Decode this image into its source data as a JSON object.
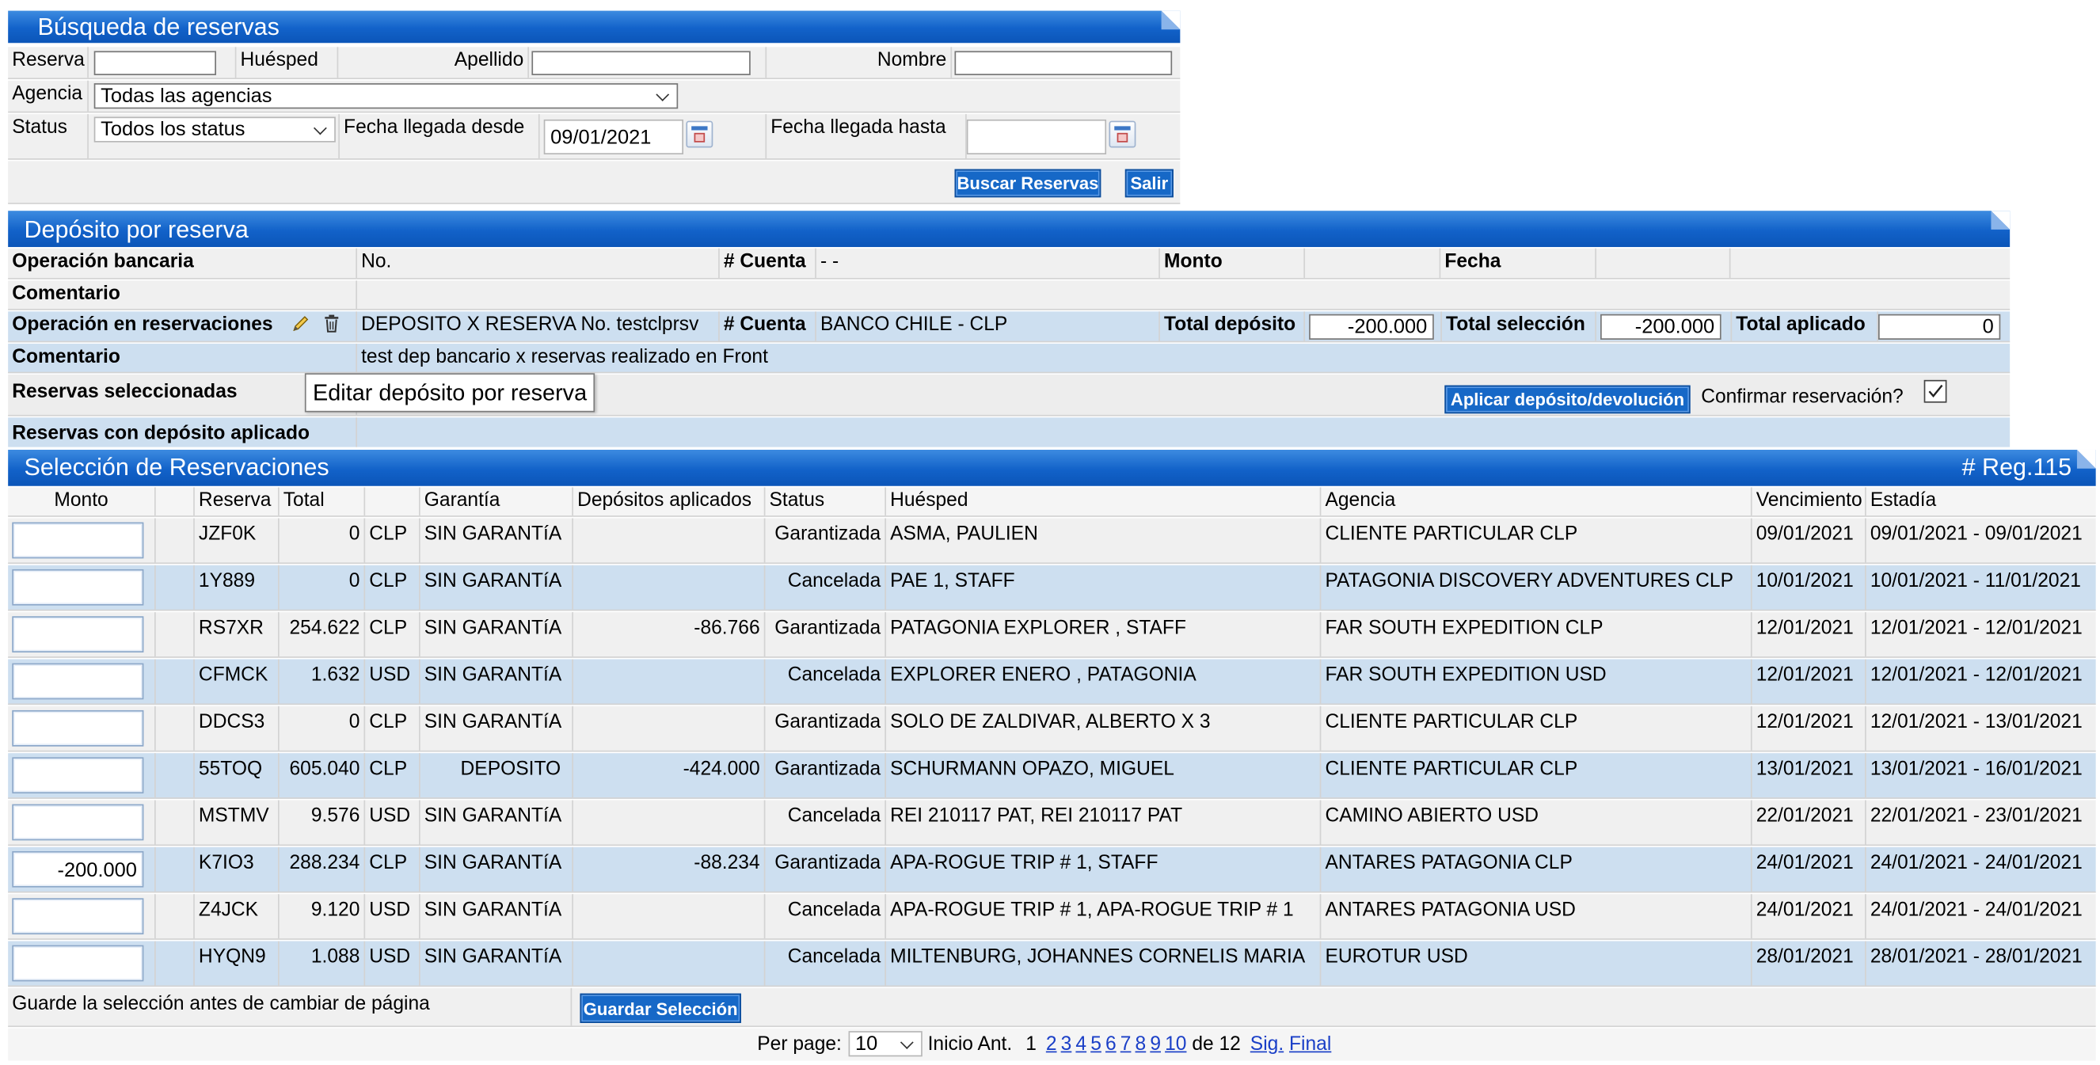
{
  "search": {
    "title": "Búsqueda de reservas",
    "reserva_label": "Reserva",
    "huesped_label": "Huésped",
    "apellido_label": "Apellido",
    "nombre_label": "Nombre",
    "agencia_label": "Agencia",
    "agencia_value": "Todas las agencias",
    "status_label": "Status",
    "status_value": "Todos los status",
    "fecha_desde_label": "Fecha llegada desde",
    "fecha_desde_value": "09/01/2021",
    "fecha_hasta_label": "Fecha llegada hasta",
    "fecha_hasta_value": "",
    "buscar_button": "Buscar Reservas",
    "salir_button": "Salir"
  },
  "deposit": {
    "title": "Depósito por reserva",
    "op_bancaria_label": "Operación bancaria",
    "no_label": "No.",
    "cuenta_label": "# Cuenta",
    "cuenta_value_1": "- -",
    "monto_label": "Monto",
    "fecha_label": "Fecha",
    "comentario_label": "Comentario",
    "op_reservas_label": "Operación en reservaciones",
    "op_reservas_value": "DEPOSITO X RESERVA No. testclprsv",
    "cuenta_value_2": "BANCO CHILE - CLP",
    "total_deposito_label": "Total depósito",
    "total_deposito_value": "-200.000",
    "total_seleccion_label": "Total selección",
    "total_seleccion_value": "-200.000",
    "total_aplicado_label": "Total aplicado",
    "total_aplicado_value": "0",
    "comentario_value": "test dep bancario x reservas realizado en Front",
    "reservas_sel_label": "Reservas seleccionadas",
    "tooltip": "Editar depósito por reserva",
    "aplicar_button": "Aplicar depósito/devolución",
    "confirmar_label": "Confirmar reservación?",
    "confirmar_checked": true,
    "reservas_aplicado_label": "Reservas con depósito aplicado"
  },
  "selection": {
    "title": "Selección de Reservaciones",
    "reg_count": "# Reg.115",
    "headers": {
      "monto": "Monto",
      "reserva": "Reserva",
      "total": "Total",
      "garantia": "Garantía",
      "depositos": "Depósitos aplicados",
      "status": "Status",
      "huesped": "Huésped",
      "agencia": "Agencia",
      "vencimiento": "Vencimiento",
      "estadia": "Estadía"
    },
    "rows": [
      {
        "monto": "",
        "reserva": "JZF0K",
        "total": "0",
        "moneda": "CLP",
        "garantia": "SIN GARANTíA",
        "depositos": "",
        "status": "Garantizada",
        "huesped": "ASMA, PAULIEN",
        "agencia": "CLIENTE PARTICULAR CLP",
        "vencimiento": "09/01/2021",
        "estadia": "09/01/2021 - 09/01/2021"
      },
      {
        "monto": "",
        "reserva": "1Y889",
        "total": "0",
        "moneda": "CLP",
        "garantia": "SIN GARANTíA",
        "depositos": "",
        "status": "Cancelada",
        "huesped": "PAE 1, STAFF",
        "agencia": "PATAGONIA DISCOVERY ADVENTURES CLP",
        "vencimiento": "10/01/2021",
        "estadia": "10/01/2021 - 11/01/2021"
      },
      {
        "monto": "",
        "reserva": "RS7XR",
        "total": "254.622",
        "moneda": "CLP",
        "garantia": "SIN GARANTíA",
        "depositos": "-86.766",
        "status": "Garantizada",
        "huesped": "PATAGONIA EXPLORER , STAFF",
        "agencia": "FAR SOUTH EXPEDITION CLP",
        "vencimiento": "12/01/2021",
        "estadia": "12/01/2021 - 12/01/2021"
      },
      {
        "monto": "",
        "reserva": "CFMCK",
        "total": "1.632",
        "moneda": "USD",
        "garantia": "SIN GARANTíA",
        "depositos": "",
        "status": "Cancelada",
        "huesped": "EXPLORER ENERO , PATAGONIA",
        "agencia": "FAR SOUTH EXPEDITION USD",
        "vencimiento": "12/01/2021",
        "estadia": "12/01/2021 - 12/01/2021"
      },
      {
        "monto": "",
        "reserva": "DDCS3",
        "total": "0",
        "moneda": "CLP",
        "garantia": "SIN GARANTíA",
        "depositos": "",
        "status": "Garantizada",
        "huesped": "SOLO DE ZALDIVAR, ALBERTO X 3",
        "agencia": "CLIENTE PARTICULAR CLP",
        "vencimiento": "12/01/2021",
        "estadia": "12/01/2021 - 13/01/2021"
      },
      {
        "monto": "",
        "reserva": "55TOQ",
        "total": "605.040",
        "moneda": "CLP",
        "garantia": "DEPOSITO",
        "depositos": "-424.000",
        "status": "Garantizada",
        "huesped": "SCHURMANN OPAZO, MIGUEL",
        "agencia": "CLIENTE PARTICULAR CLP",
        "vencimiento": "13/01/2021",
        "estadia": "13/01/2021 - 16/01/2021"
      },
      {
        "monto": "",
        "reserva": "MSTMV",
        "total": "9.576",
        "moneda": "USD",
        "garantia": "SIN GARANTíA",
        "depositos": "",
        "status": "Cancelada",
        "huesped": "REI 210117 PAT, REI 210117 PAT",
        "agencia": "CAMINO ABIERTO USD",
        "vencimiento": "22/01/2021",
        "estadia": "22/01/2021 - 23/01/2021"
      },
      {
        "monto": "-200.000",
        "reserva": "K7IO3",
        "total": "288.234",
        "moneda": "CLP",
        "garantia": "SIN GARANTíA",
        "depositos": "-88.234",
        "status": "Garantizada",
        "huesped": "APA-ROGUE TRIP # 1, STAFF",
        "agencia": "ANTARES PATAGONIA CLP",
        "vencimiento": "24/01/2021",
        "estadia": "24/01/2021 - 24/01/2021"
      },
      {
        "monto": "",
        "reserva": "Z4JCK",
        "total": "9.120",
        "moneda": "USD",
        "garantia": "SIN GARANTíA",
        "depositos": "",
        "status": "Cancelada",
        "huesped": "APA-ROGUE TRIP # 1, APA-ROGUE TRIP # 1",
        "agencia": "ANTARES PATAGONIA USD",
        "vencimiento": "24/01/2021",
        "estadia": "24/01/2021 - 24/01/2021"
      },
      {
        "monto": "",
        "reserva": "HYQN9",
        "total": "1.088",
        "moneda": "USD",
        "garantia": "SIN GARANTíA",
        "depositos": "",
        "status": "Cancelada",
        "huesped": "MILTENBURG, JOHANNES CORNELIS MARIA",
        "agencia": "EUROTUR USD",
        "vencimiento": "28/01/2021",
        "estadia": "28/01/2021 - 28/01/2021"
      }
    ],
    "save_note": "Guarde la selección antes de cambiar de página",
    "save_button": "Guardar Selección"
  },
  "pagination": {
    "per_page_label": "Per page:",
    "per_page_value": "10",
    "inicio": "Inicio",
    "ant": "Ant.",
    "current": "1",
    "pages": [
      "2",
      "3",
      "4",
      "5",
      "6",
      "7",
      "8",
      "9",
      "10"
    ],
    "de_label": "de",
    "total_pages": "12",
    "sig": "Sig.",
    "final": "Final"
  },
  "colors": {
    "header_blue": "#1262c9",
    "row_light": "#f0f0f0",
    "row_blue": "#cddff0",
    "button_blue": "#1668c7"
  }
}
